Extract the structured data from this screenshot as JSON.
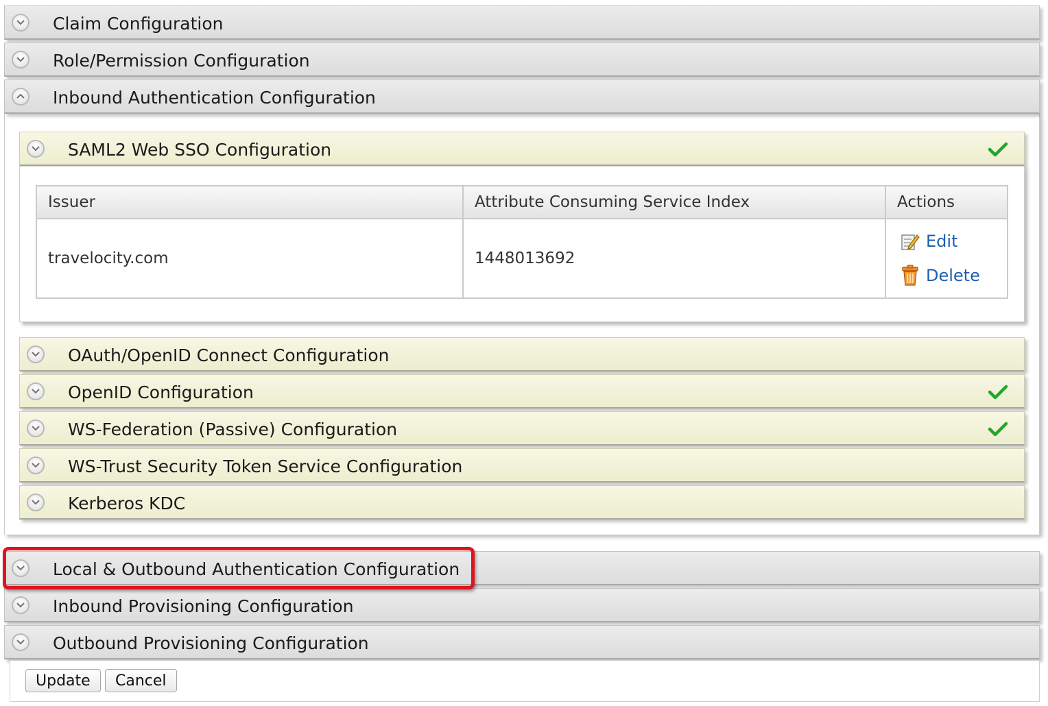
{
  "outer_sections": [
    {
      "id": "claim",
      "title": "Claim Configuration",
      "expanded": false
    },
    {
      "id": "role",
      "title": "Role/Permission Configuration",
      "expanded": false
    },
    {
      "id": "inbound-auth",
      "title": "Inbound Authentication Configuration",
      "expanded": true
    },
    {
      "id": "local-outbound",
      "title": "Local & Outbound Authentication Configuration",
      "expanded": false,
      "highlighted": true
    },
    {
      "id": "inbound-prov",
      "title": "Inbound Provisioning Configuration",
      "expanded": false
    },
    {
      "id": "outbound-prov",
      "title": "Outbound Provisioning Configuration",
      "expanded": false
    }
  ],
  "inbound_subsections": [
    {
      "id": "saml2",
      "title": "SAML2 Web SSO Configuration",
      "configured": true,
      "expanded": true
    },
    {
      "id": "oauth",
      "title": "OAuth/OpenID Connect Configuration",
      "configured": false
    },
    {
      "id": "openid",
      "title": "OpenID Configuration",
      "configured": true
    },
    {
      "id": "wsfed",
      "title": "WS-Federation (Passive) Configuration",
      "configured": true
    },
    {
      "id": "wstrust",
      "title": "WS-Trust Security Token Service Configuration",
      "configured": false
    },
    {
      "id": "kerberos",
      "title": "Kerberos KDC",
      "configured": false
    }
  ],
  "saml_table": {
    "headers": [
      "Issuer",
      "Attribute Consuming Service Index",
      "Actions"
    ],
    "rows": [
      {
        "issuer": "travelocity.com",
        "index": "1448013692"
      }
    ],
    "actions": {
      "edit": "Edit",
      "delete": "Delete"
    }
  },
  "buttons": {
    "update": "Update",
    "cancel": "Cancel"
  },
  "colors": {
    "check": "#22a52b",
    "link": "#1f5fb0",
    "highlight": "#e0141e"
  },
  "icons": {
    "collapsed": "chevron-down-icon",
    "expanded": "chevron-up-icon",
    "configured": "checkmark-icon",
    "edit": "edit-icon",
    "delete": "trash-icon"
  }
}
